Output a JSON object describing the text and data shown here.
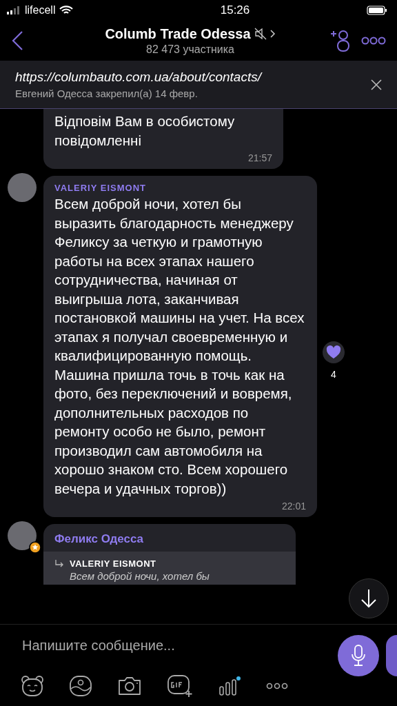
{
  "status_bar": {
    "carrier": "lifecell",
    "time": "15:26"
  },
  "header": {
    "title": "Columb Trade Odessa",
    "subtitle": "82 473 участника",
    "muted": true
  },
  "pinned": {
    "text": "https://columbauto.com.ua/about/contacts/",
    "meta": "Евгений Одесса закрепил(а) 14 февр."
  },
  "messages": [
    {
      "kind": "text",
      "text": "Відповім Вам в особистому повідомленні",
      "time": "21:57"
    },
    {
      "kind": "text",
      "sender": "VALERIY EISMONT",
      "text": "Всем доброй ночи, хотел бы выразить благодарность менеджеру Феликсу за  четкую и грамотную работы на всех этапах нашего сотрудничества, начиная от выигрыша лота, заканчивая постановкой машины на учет. На всех этапах я получал своевременную и квалифицированную помощь. Машина пришла точь в точь как на фото, без переключений и вовремя, дополнительных расходов по ремонту особо не было, ремонт производил сам автомобиля на хорошо знаком сто. Всем хорошего вечера и удачных торгов))",
      "time": "22:01",
      "reaction": {
        "count": "4"
      }
    },
    {
      "kind": "reply",
      "sender": "Феликс Одесса",
      "admin": true,
      "quote_author": "VALERIY EISMONT",
      "quote_text": "Всем доброй ночи, хотел бы"
    }
  ],
  "composer": {
    "placeholder": "Напишите сообщение..."
  }
}
